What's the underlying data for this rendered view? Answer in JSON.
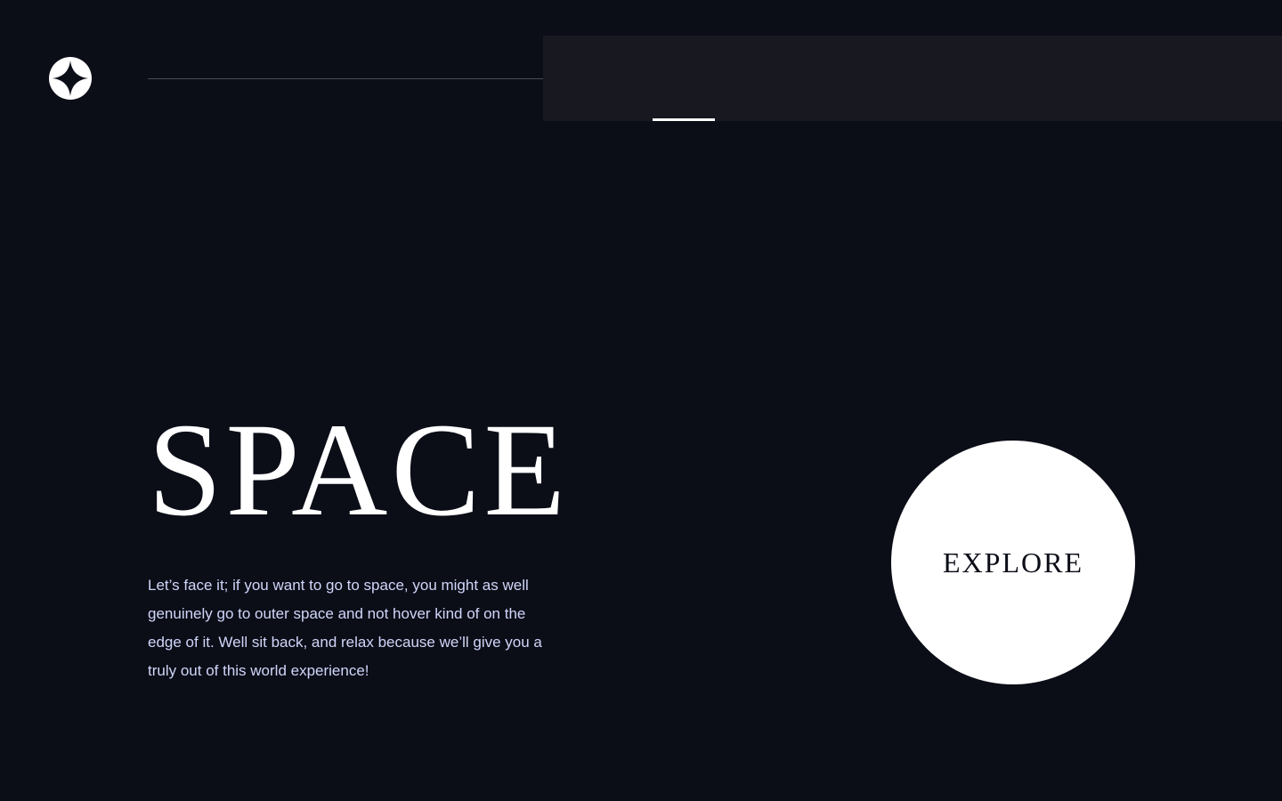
{
  "header": {
    "logo_icon": "four-point-star-icon"
  },
  "nav": {
    "items": []
  },
  "hero": {
    "title": "SPACE",
    "description": "Let’s face it; if you want to go to space, you might as well genuinely go to outer space and not hover kind of on the edge of it. Well sit back, and relax because we’ll give you a truly out of this world experience!"
  },
  "cta": {
    "label": "EXPLORE"
  },
  "colors": {
    "background": "#0b0d17",
    "nav_panel": "#181820",
    "text_primary": "#ffffff",
    "text_secondary": "#d0d6f9"
  }
}
